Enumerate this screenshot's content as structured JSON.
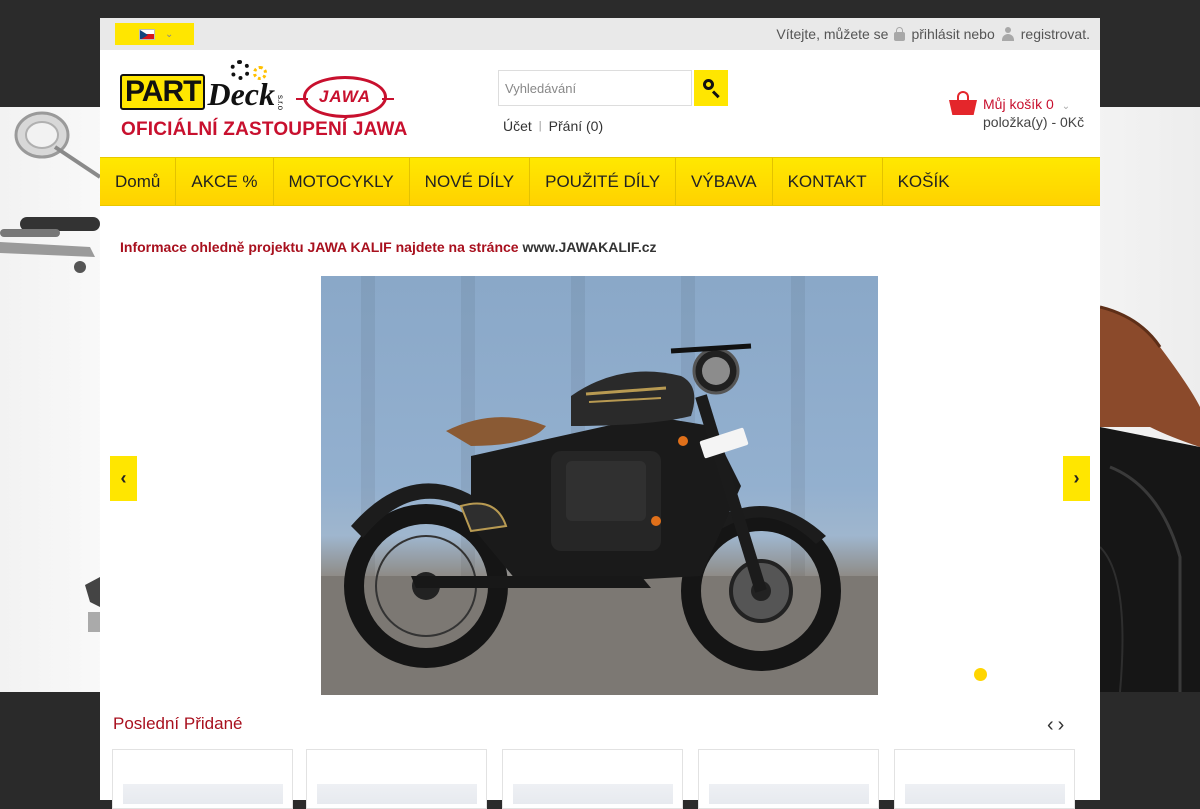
{
  "topbar": {
    "language": "cs",
    "welcome_text": "Vítejte, můžete se",
    "login_link": "přihlásit nebo",
    "register_link": "registrovat."
  },
  "logo": {
    "brand_part": "PART",
    "brand_deck": "Deck",
    "brand_sro": "s.r.o",
    "jawa": "JAWA",
    "slogan": "OFICIÁLNÍ ZASTOUPENÍ JAWA"
  },
  "search": {
    "placeholder": "Vyhledávání",
    "value": ""
  },
  "account_links": {
    "account": "Účet",
    "separator": "|",
    "wishlist": "Přání (0)"
  },
  "cart": {
    "title": "Můj košík",
    "count": "0",
    "items_text": "položka(y) - 0Kč"
  },
  "nav": {
    "items": [
      {
        "label": "Domů"
      },
      {
        "label": "AKCE %"
      },
      {
        "label": "MOTOCYKLY"
      },
      {
        "label": "NOVÉ DÍLY"
      },
      {
        "label": "POUŽITÉ DÍLY"
      },
      {
        "label": "VÝBAVA"
      },
      {
        "label": "KONTAKT"
      },
      {
        "label": "KOŠÍK"
      }
    ]
  },
  "info": {
    "text": "Informace ohledně projektu JAWA KALIF najdete na stránce ",
    "link": "www.JAWAKALIF.cz"
  },
  "slider": {
    "slide_count": 1,
    "active_slide": 1
  },
  "latest": {
    "title": "Poslední Přidané",
    "prev": "‹",
    "next": "›",
    "card_count": 5
  },
  "colors": {
    "accent_yellow": "#ffe600",
    "brand_red": "#c8102e",
    "background_dark": "#2b2b2b"
  }
}
